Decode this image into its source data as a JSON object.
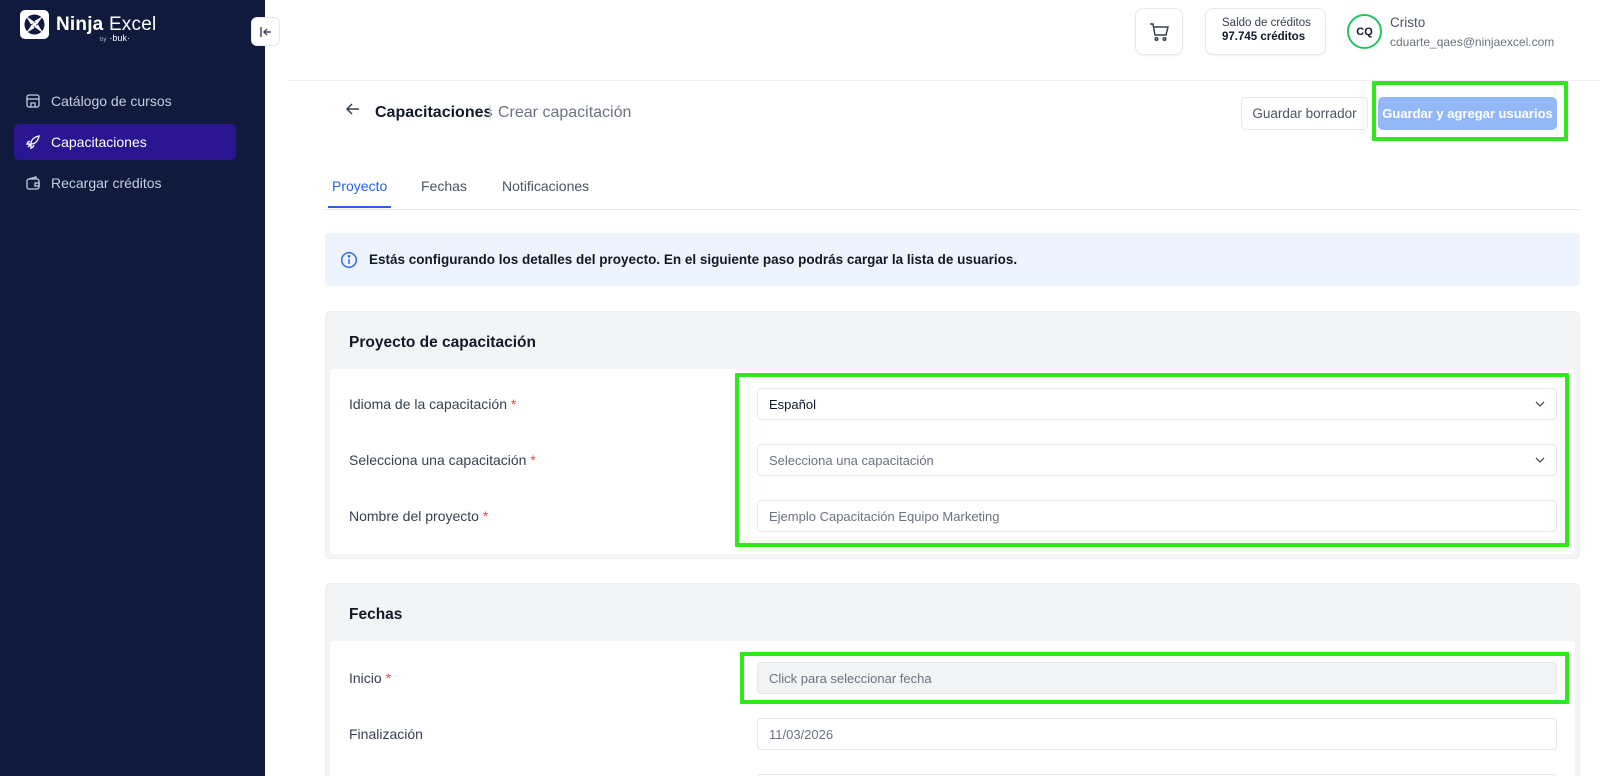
{
  "brand": {
    "name_bold": "Ninja",
    "name_light": "Excel",
    "by_prefix": "by",
    "by_name": "·buk·"
  },
  "sidebar": {
    "items": [
      {
        "label": "Catálogo de cursos",
        "icon": "store-icon",
        "active": false
      },
      {
        "label": "Capacitaciones",
        "icon": "rocket-icon",
        "active": true
      },
      {
        "label": "Recargar créditos",
        "icon": "wallet-icon",
        "active": false
      }
    ]
  },
  "header": {
    "credits_label": "Saldo de créditos",
    "credits_value": "97.745 créditos",
    "user_initials": "CQ",
    "user_name": "Cristo",
    "user_email": "cduarte_qaes@ninjaexcel.com"
  },
  "page": {
    "breadcrumb_main": "Capacitaciones",
    "breadcrumb_sep": "|",
    "breadcrumb_sub": "Crear capacitación",
    "draft_button": "Guardar borrador",
    "primary_button": "Guardar y agregar usuarios"
  },
  "tabs": [
    {
      "label": "Proyecto",
      "active": true
    },
    {
      "label": "Fechas",
      "active": false
    },
    {
      "label": "Notificaciones",
      "active": false
    }
  ],
  "info_banner": "Estás configurando los detalles del proyecto. En el siguiente paso podrás cargar la lista de usuarios.",
  "project_section": {
    "title": "Proyecto de capacitación",
    "fields": [
      {
        "label": "Idioma de la capacitación",
        "required": "*",
        "value": "Español",
        "type": "select"
      },
      {
        "label": "Selecciona una capacitación",
        "required": "*",
        "placeholder": "Selecciona una capacitación",
        "type": "select"
      },
      {
        "label": "Nombre del proyecto",
        "required": "*",
        "placeholder": "Ejemplo Capacitación Equipo Marketing",
        "type": "text"
      }
    ]
  },
  "dates_section": {
    "title": "Fechas",
    "fields": [
      {
        "label": "Inicio",
        "required": "*",
        "placeholder": "Click para seleccionar fecha"
      },
      {
        "label": "Finalización",
        "value": "11/03/2026"
      }
    ]
  },
  "colors": {
    "sidebar_bg": "#0f1a3c",
    "sidebar_active": "#2a148f",
    "accent_blue": "#2563eb",
    "primary_button_disabled": "#93b8f8",
    "highlight_green": "#2ee81a",
    "avatar_ring": "#22c55e"
  }
}
